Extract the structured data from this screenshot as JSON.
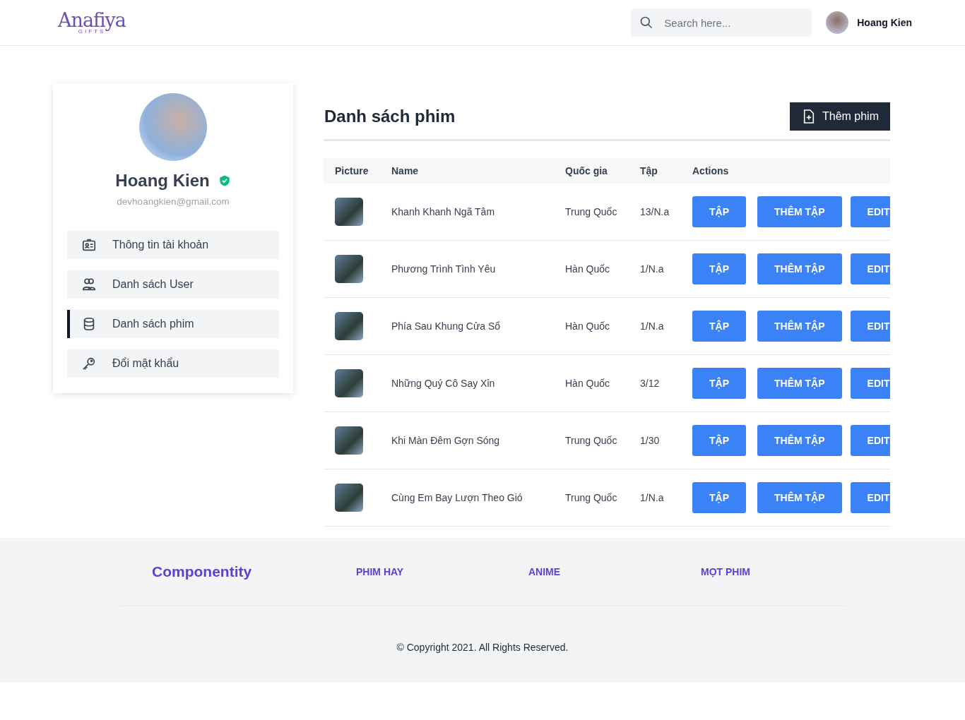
{
  "header": {
    "logo": {
      "name": "Anafiya",
      "tagline": "GIFTS"
    },
    "search": {
      "placeholder": "Search here..."
    },
    "user": {
      "name": "Hoang Kien"
    }
  },
  "profile": {
    "name": "Hoang Kien",
    "verified": true,
    "email": "devhoangkien@gmail.com"
  },
  "menu": [
    {
      "label": "Thông tin tài khoản",
      "kind": "account",
      "selected": false
    },
    {
      "label": "Danh sách User",
      "kind": "users",
      "selected": false
    },
    {
      "label": "Danh sách phim",
      "kind": "movies",
      "selected": true
    },
    {
      "label": "Đổi mật khẩu",
      "kind": "password",
      "selected": false
    }
  ],
  "main": {
    "title": "Danh sách phim",
    "add_button": "Thêm phim",
    "table": {
      "columns": [
        "Picture",
        "Name",
        "Quốc gia",
        "Tập",
        "Actions"
      ],
      "rows": [
        {
          "name": "Khanh Khanh Ngã Tâm",
          "country": "Trung Quốc",
          "episodes": "13/N.a",
          "actions": [
            "TẬP",
            "THÊM TẬP",
            "EDIT"
          ]
        },
        {
          "name": "Phương Trình Tình Yêu",
          "country": "Hàn Quốc",
          "episodes": "1/N.a",
          "actions": [
            "TẬP",
            "THÊM TẬP",
            "EDIT"
          ]
        },
        {
          "name": "Phía Sau Khung Cửa Sổ",
          "country": "Hàn Quốc",
          "episodes": "1/N.a",
          "actions": [
            "TẬP",
            "THÊM TẬP",
            "EDIT"
          ]
        },
        {
          "name": "Những Quý Cô Say Xỉn",
          "country": "Hàn Quốc",
          "episodes": "3/12",
          "actions": [
            "TẬP",
            "THÊM TẬP",
            "EDIT"
          ]
        },
        {
          "name": "Khi Màn Đêm Gợn Sóng",
          "country": "Trung Quốc",
          "episodes": "1/30",
          "actions": [
            "TẬP",
            "THÊM TẬP",
            "EDIT"
          ]
        },
        {
          "name": "Cùng Em Bay Lượn Theo Gió",
          "country": "Trung Quốc",
          "episodes": "1/N.a",
          "actions": [
            "TẬP",
            "THÊM TẬP",
            "EDIT"
          ]
        }
      ]
    }
  },
  "footer": {
    "brand": "Componentity",
    "links": [
      "PHIM HAY",
      "ANIME",
      "MỌT PHIM"
    ],
    "copyright": "© Copyright 2021. All Rights Reserved."
  }
}
